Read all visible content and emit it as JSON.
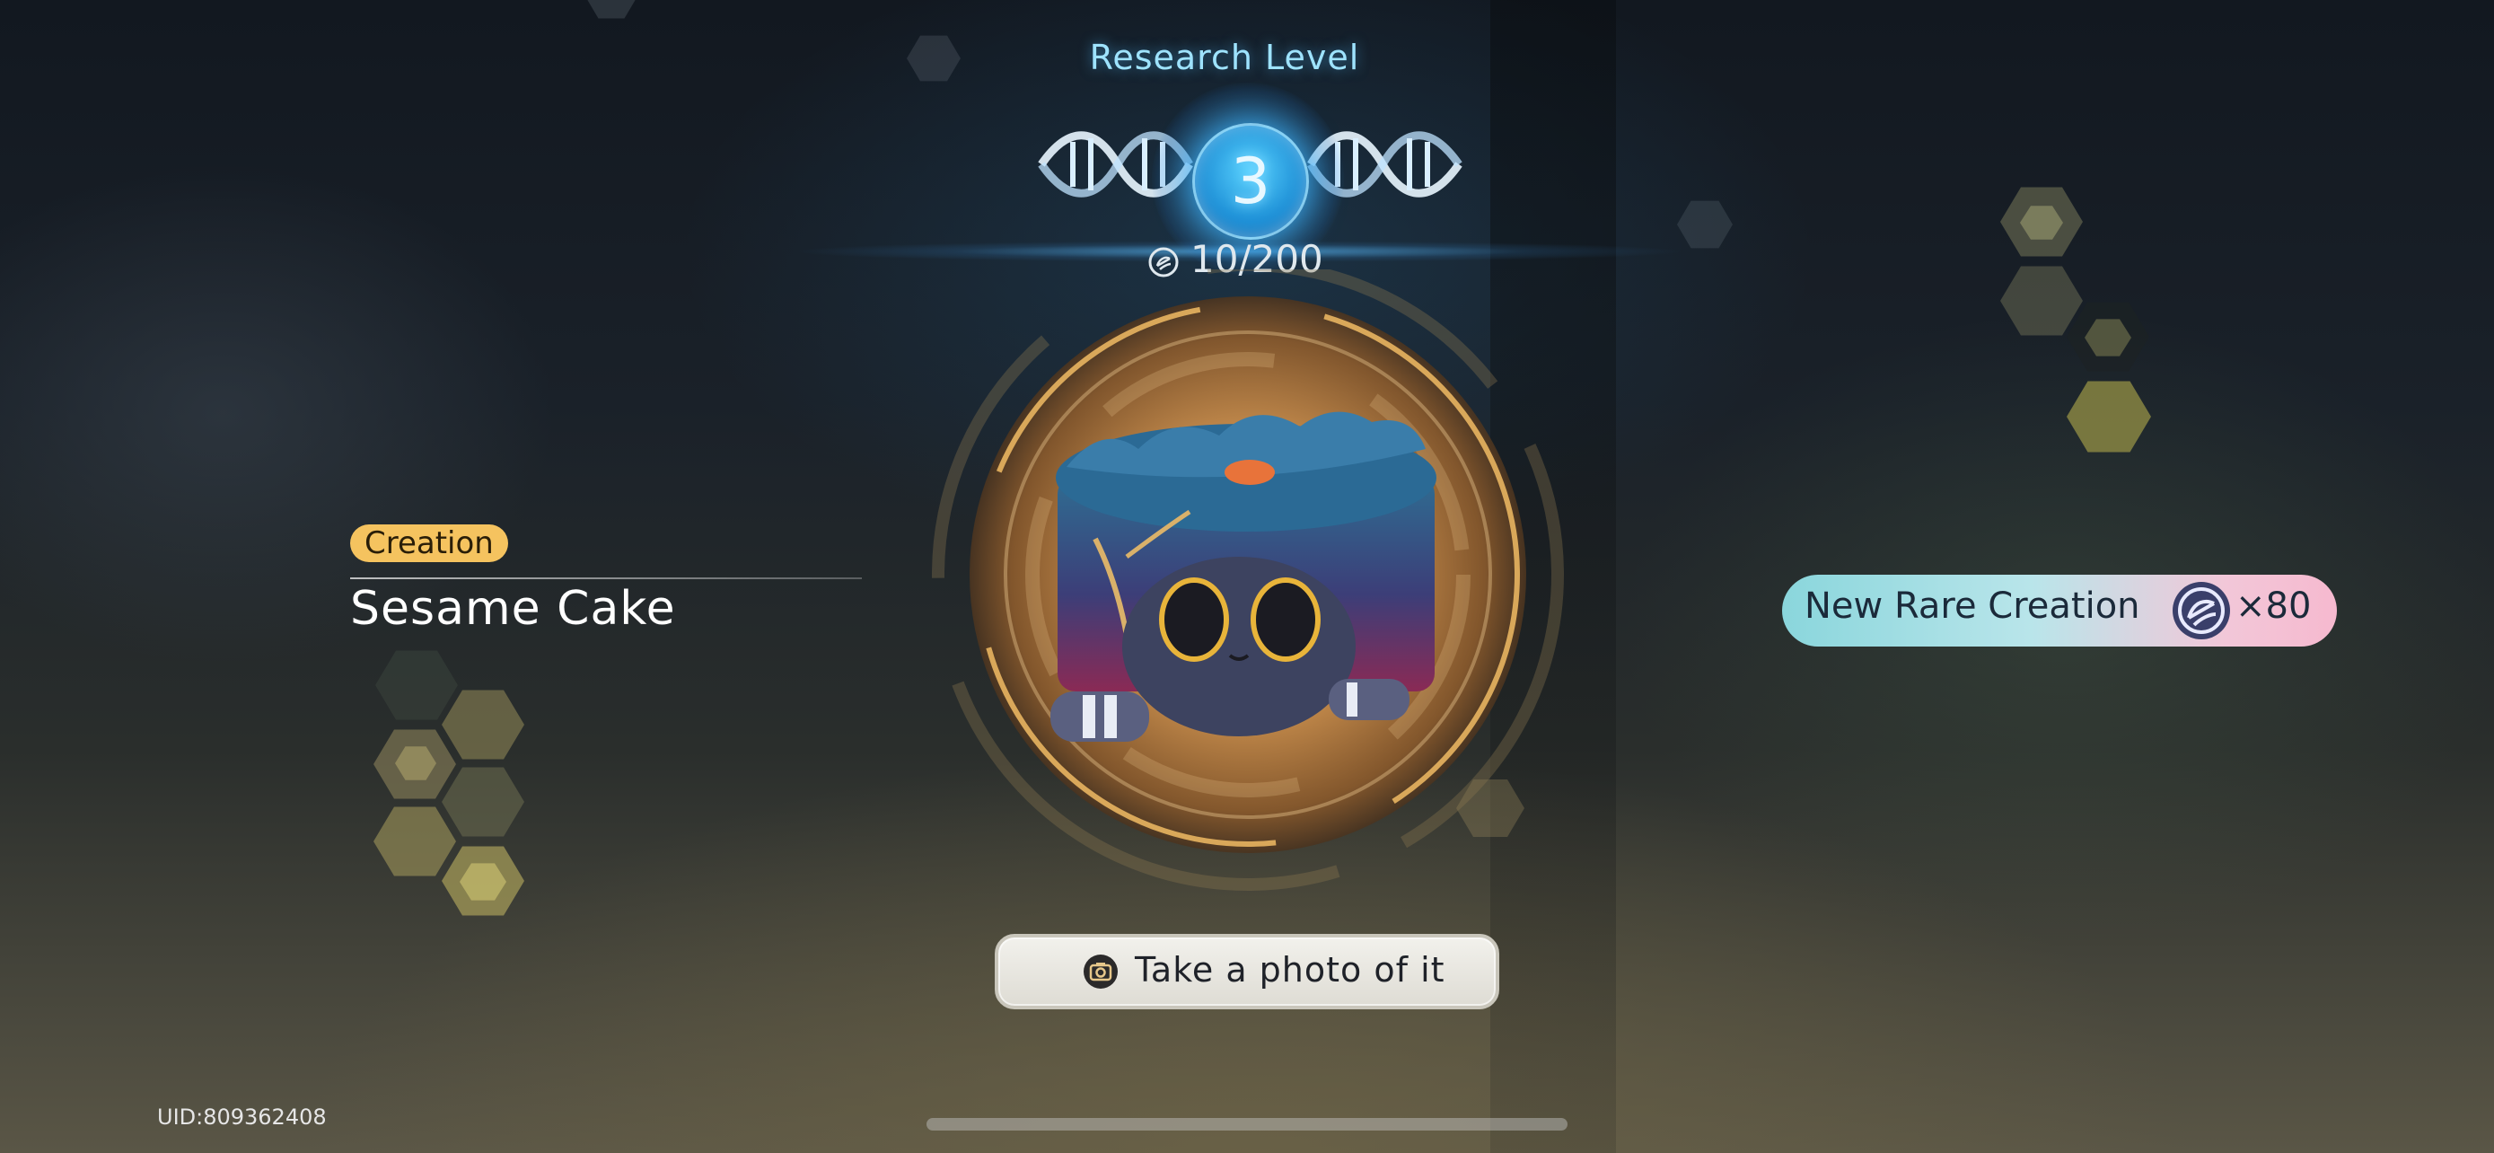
{
  "header": {
    "title": "Research Level",
    "level": "3",
    "progress_current": "10",
    "progress_max": "/200",
    "progress_icon": "research-points-icon"
  },
  "item": {
    "category": "Creation",
    "name": "Sesame Cake",
    "image": "sesame-cake-creature-illustration"
  },
  "reward": {
    "label": "New Rare Creation",
    "icon": "research-points-icon",
    "amount": "×80"
  },
  "actions": {
    "photo_label": "Take a photo of it",
    "photo_icon": "camera-icon"
  },
  "footer": {
    "uid": "UID:809362408"
  },
  "colors": {
    "accent_blue": "#5ad2ff",
    "badge_gold": "#f5c35f",
    "ring_gold": "#d9a85a"
  }
}
